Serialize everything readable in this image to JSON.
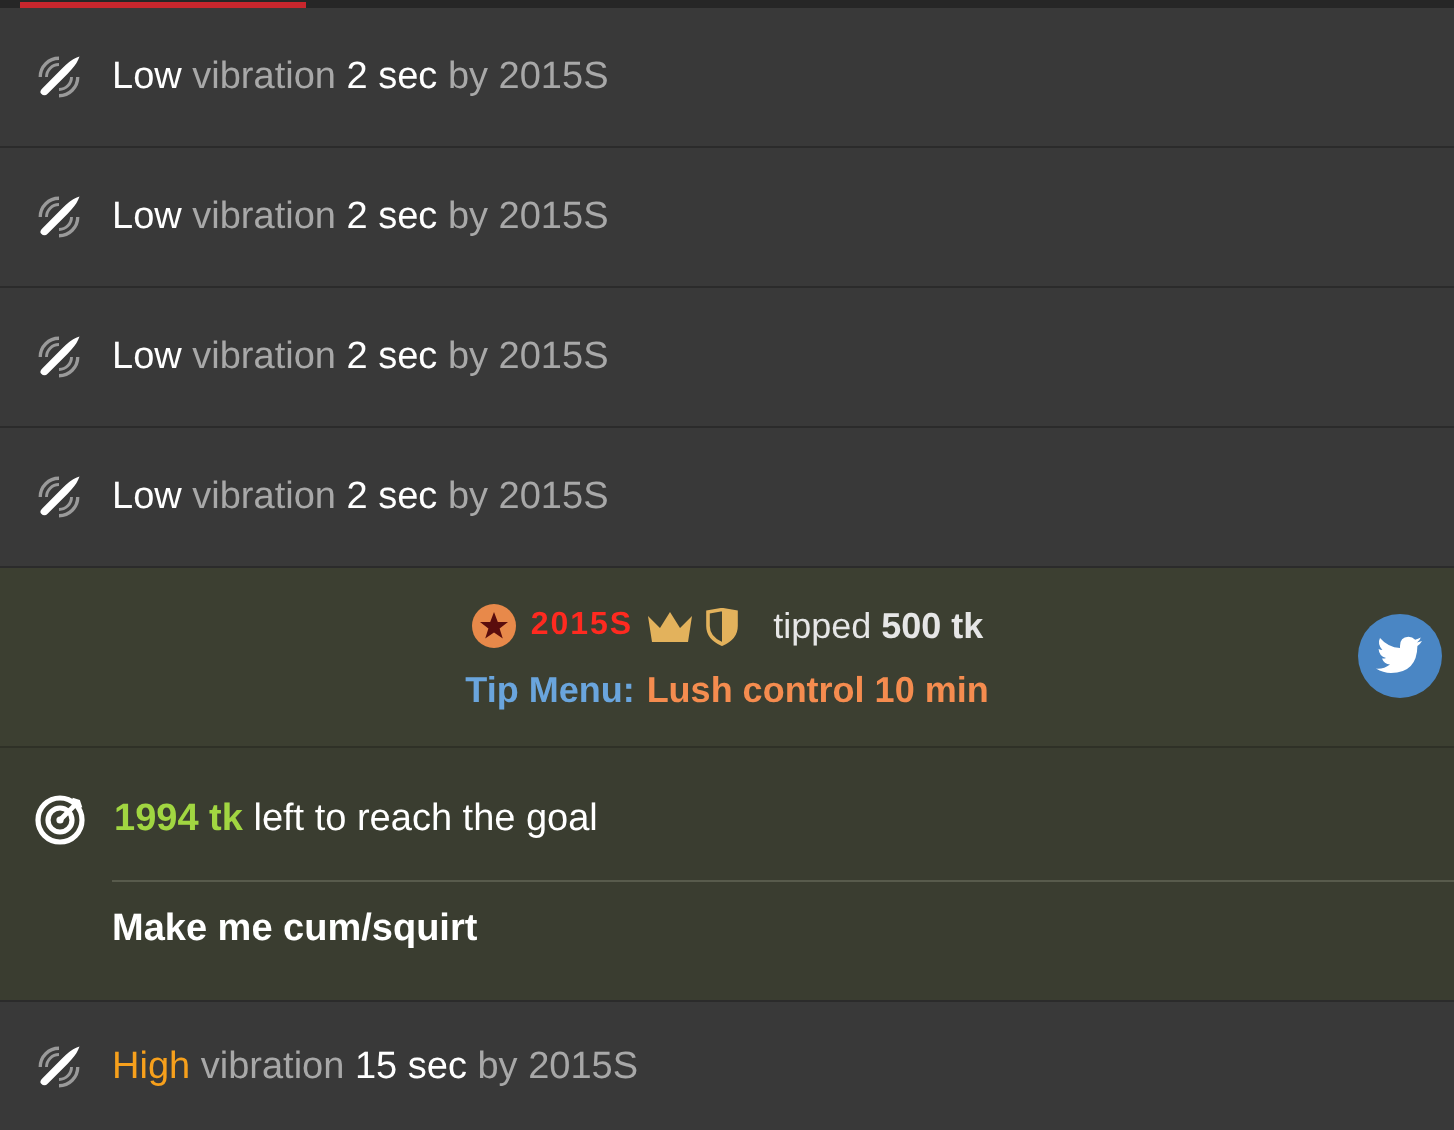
{
  "vibrations": [
    {
      "kind": "low",
      "strength": "Low",
      "word": "vibration",
      "duration": "2 sec",
      "by": "by 2015S"
    },
    {
      "kind": "low",
      "strength": "Low",
      "word": "vibration",
      "duration": "2 sec",
      "by": "by 2015S"
    },
    {
      "kind": "low",
      "strength": "Low",
      "word": "vibration",
      "duration": "2 sec",
      "by": "by 2015S"
    },
    {
      "kind": "low",
      "strength": "Low",
      "word": "vibration",
      "duration": "2 sec",
      "by": "by 2015S"
    }
  ],
  "tip": {
    "user": "2015S",
    "action": "tipped",
    "amount": "500 tk",
    "menu_label": "Tip Menu:",
    "menu_item": "Lush control 10 min"
  },
  "goal": {
    "amount": "1994 tk",
    "text": "left to reach the goal",
    "title": "Make me cum/squirt"
  },
  "last_vibration": {
    "kind": "high",
    "strength": "High",
    "word": "vibration",
    "duration": "15 sec",
    "by": "by 2015S"
  }
}
